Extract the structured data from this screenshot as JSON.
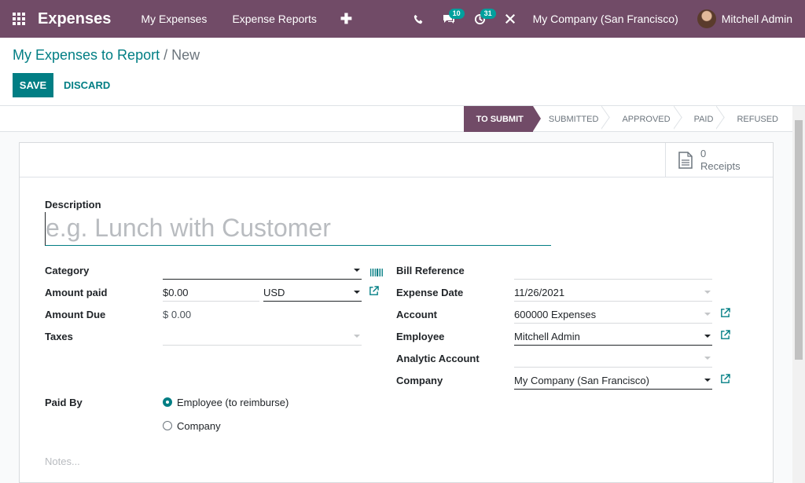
{
  "navbar": {
    "app_name": "Expenses",
    "menu": [
      "My Expenses",
      "Expense Reports"
    ],
    "chat_count": "10",
    "activity_count": "31",
    "company": "My Company (San Francisco)",
    "user": "Mitchell Admin"
  },
  "breadcrumb": {
    "parent": "My Expenses to Report",
    "separator": "/",
    "current": "New"
  },
  "buttons": {
    "save": "SAVE",
    "discard": "DISCARD"
  },
  "stages": [
    "TO SUBMIT",
    "SUBMITTED",
    "APPROVED",
    "PAID",
    "REFUSED"
  ],
  "active_stage": "TO SUBMIT",
  "receipts": {
    "count": "0",
    "label": "Receipts"
  },
  "form": {
    "description_label": "Description",
    "description_placeholder": "e.g. Lunch with Customer",
    "category_label": "Category",
    "category_value": "",
    "amount_paid_label": "Amount paid",
    "amount_paid_value": "$0.00",
    "currency_value": "USD",
    "amount_due_label": "Amount Due",
    "amount_due_value": "$ 0.00",
    "taxes_label": "Taxes",
    "taxes_value": "",
    "bill_reference_label": "Bill Reference",
    "bill_reference_value": "",
    "expense_date_label": "Expense Date",
    "expense_date_value": "11/26/2021",
    "account_label": "Account",
    "account_value": "600000 Expenses",
    "employee_label": "Employee",
    "employee_value": "Mitchell Admin",
    "analytic_account_label": "Analytic Account",
    "analytic_account_value": "",
    "company_label": "Company",
    "company_value": "My Company (San Francisco)",
    "paid_by_label": "Paid By",
    "paid_by_options": [
      "Employee (to reimburse)",
      "Company"
    ],
    "paid_by_selected": "Employee (to reimburse)",
    "notes_placeholder": "Notes..."
  },
  "colors": {
    "brand": "#714b67",
    "accent": "#017e84",
    "badge": "#00a09d"
  }
}
